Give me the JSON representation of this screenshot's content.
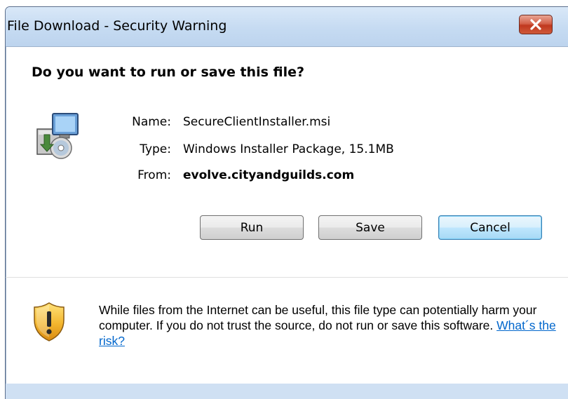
{
  "window": {
    "title": "File Download - Security Warning"
  },
  "prompt": {
    "question": "Do you want to run or save this file?"
  },
  "file": {
    "name_label": "Name:",
    "name_value": "SecureClientInstaller.msi",
    "type_label": "Type:",
    "type_value": "Windows Installer Package, 15.1MB",
    "from_label": "From:",
    "from_value": "evolve.cityandguilds.com"
  },
  "buttons": {
    "run": "Run",
    "save": "Save",
    "cancel": "Cancel"
  },
  "warning": {
    "text": "While files from the Internet can be useful, this file type can potentially harm your computer. If you do not trust the source, do not run or save this software. ",
    "link": "What´s the risk?"
  },
  "icons": {
    "close": "close-icon",
    "file": "installer-package-icon",
    "security": "security-shield-icon"
  },
  "colors": {
    "titlebar": "#c6dbf2",
    "close_button": "#c0381f",
    "link": "#0066cc",
    "shield": "#e8a52a"
  }
}
